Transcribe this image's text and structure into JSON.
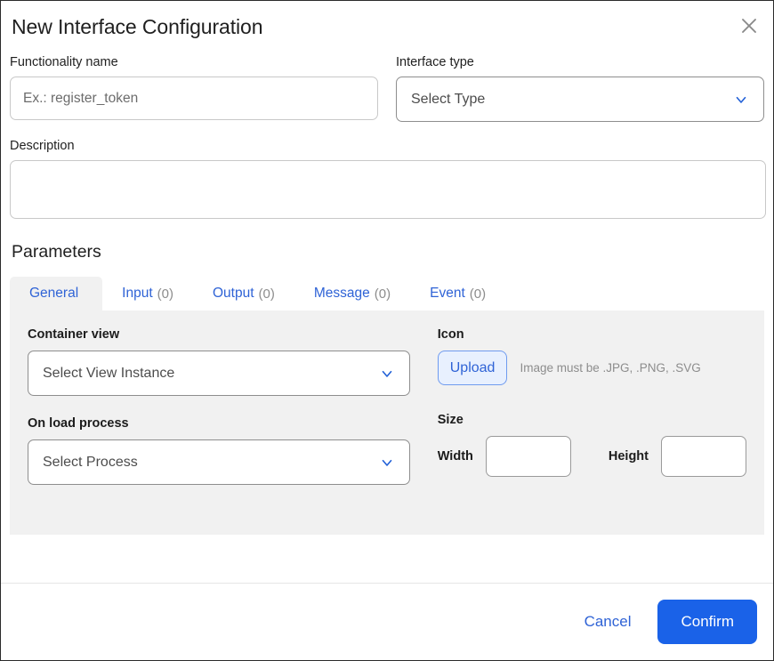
{
  "dialog": {
    "title": "New Interface Configuration",
    "close_icon": "close-icon"
  },
  "form": {
    "functionality_name": {
      "label": "Functionality name",
      "placeholder": "Ex.: register_token",
      "value": ""
    },
    "interface_type": {
      "label": "Interface type",
      "selected": "Select Type",
      "chevron_icon": "chevron-down-icon"
    },
    "description": {
      "label": "Description",
      "placeholder": "",
      "value": ""
    }
  },
  "parameters": {
    "heading": "Parameters",
    "tabs": [
      {
        "label": "General",
        "count": "",
        "active": true
      },
      {
        "label": "Input",
        "count": "(0)",
        "active": false
      },
      {
        "label": "Output",
        "count": "(0)",
        "active": false
      },
      {
        "label": "Message",
        "count": "(0)",
        "active": false
      },
      {
        "label": "Event",
        "count": "(0)",
        "active": false
      }
    ],
    "general": {
      "container_view": {
        "label": "Container view",
        "selected": "Select View Instance",
        "chevron_icon": "chevron-down-icon"
      },
      "on_load_process": {
        "label": "On load process",
        "selected": "Select Process",
        "chevron_icon": "chevron-down-icon"
      },
      "icon": {
        "label": "Icon",
        "upload_label": "Upload",
        "hint": "Image must be .JPG, .PNG, .SVG"
      },
      "size": {
        "label": "Size",
        "width_label": "Width",
        "width_value": "",
        "height_label": "Height",
        "height_value": ""
      }
    }
  },
  "footer": {
    "cancel_label": "Cancel",
    "confirm_label": "Confirm"
  },
  "colors": {
    "accent_blue": "#2f63d6",
    "primary_button": "#1a62e8",
    "panel_gray": "#f1f1f1",
    "upload_bg": "#e8f0fe"
  }
}
